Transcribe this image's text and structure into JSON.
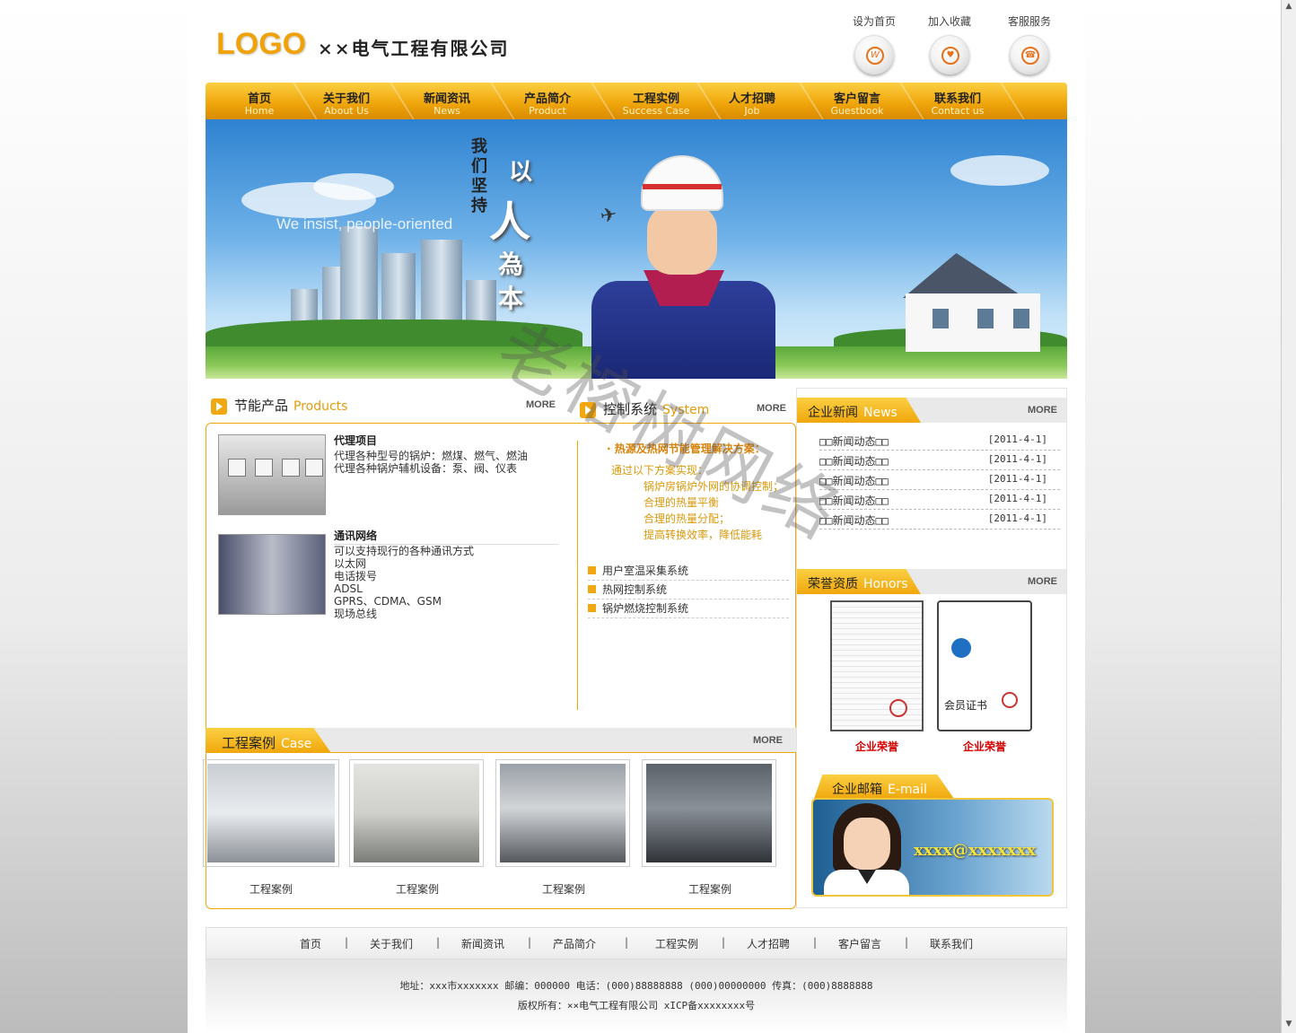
{
  "header": {
    "logo": "LOGO",
    "company": "××电气工程有限公司",
    "links": [
      {
        "label": "设为首页",
        "icon": "home-page-icon"
      },
      {
        "label": "加入收藏",
        "icon": "favorite-icon"
      },
      {
        "label": "客服服务",
        "icon": "service-phone-icon"
      }
    ]
  },
  "nav": [
    {
      "cn": "首页",
      "en": "Home"
    },
    {
      "cn": "关于我们",
      "en": "About Us"
    },
    {
      "cn": "新闻资讯",
      "en": "News"
    },
    {
      "cn": "产品简介",
      "en": "Product"
    },
    {
      "cn": "工程实例",
      "en": "Success Case"
    },
    {
      "cn": "人才招聘",
      "en": "Job"
    },
    {
      "cn": "客户留言",
      "en": "Guestbook"
    },
    {
      "cn": "联系我们",
      "en": "Contact us"
    }
  ],
  "banner": {
    "slogan_small": "我们坚持",
    "slogan_1": "以",
    "slogan_2": "人",
    "slogan_3": "為",
    "slogan_4": "本",
    "english": "We insist, people-oriented"
  },
  "products": {
    "title": "节能产品",
    "title_en": "Products",
    "more": "MORE",
    "items": [
      {
        "heading": "代理项目",
        "lines": [
          "代理各种型号的锅炉：燃煤、燃气、燃油",
          "代理各种锅炉辅机设备：泵、阀、仪表"
        ]
      },
      {
        "heading": "通讯网络",
        "lines": [
          "可以支持现行的各种通讯方式",
          "以太网",
          "电话拨号",
          "ADSL",
          "GPRS、CDMA、GSM",
          "现场总线"
        ]
      }
    ]
  },
  "system": {
    "title": "控制系统",
    "title_en": "System",
    "more": "MORE",
    "headline": "· 热源及热网节能管理解决方案：",
    "intro": "通过以下方案实现：",
    "points": [
      "锅炉房锅炉外网的协调控制；",
      "合理的热量平衡",
      "合理的热量分配；",
      "提高转换效率，降低能耗"
    ],
    "list": [
      "用户室温采集系统",
      "热网控制系统",
      "锅炉燃烧控制系统"
    ]
  },
  "cases": {
    "title": "工程案例",
    "title_en": "Case",
    "more": "MORE",
    "items": [
      "工程案例",
      "工程案例",
      "工程案例",
      "工程案例"
    ]
  },
  "news": {
    "title": "企业新闻",
    "title_en": "News",
    "more": "MORE",
    "items": [
      {
        "title": "□□新闻动态□□",
        "date": "[2011-4-1]"
      },
      {
        "title": "□□新闻动态□□",
        "date": "[2011-4-1]"
      },
      {
        "title": "□□新闻动态□□",
        "date": "[2011-4-1]"
      },
      {
        "title": "□□新闻动态□□",
        "date": "[2011-4-1]"
      },
      {
        "title": "□□新闻动态□□",
        "date": "[2011-4-1]"
      }
    ]
  },
  "honors": {
    "title": "荣誉资质",
    "title_en": "Honors",
    "more": "MORE",
    "items": [
      "企业荣誉",
      "企业荣誉"
    ],
    "cert2_text": "会员证书"
  },
  "email": {
    "title": "企业邮箱",
    "title_en": "E-mail",
    "address": "xxxx@xxxxxxx"
  },
  "footer": {
    "links": [
      "首页",
      "关于我们",
      "新闻资讯",
      "产品简介",
      "工程实例",
      "人才招聘",
      "客户留言",
      "联系我们"
    ],
    "separator": "|",
    "address": "地址：xxx市xxxxxxx 邮编：000000 电话：(000)88888888 (000)00000000 传真：(000)8888888",
    "copyright": "版权所有：××电气工程有限公司   xICP备xxxxxxxx号"
  },
  "watermark": "老榕树网络"
}
